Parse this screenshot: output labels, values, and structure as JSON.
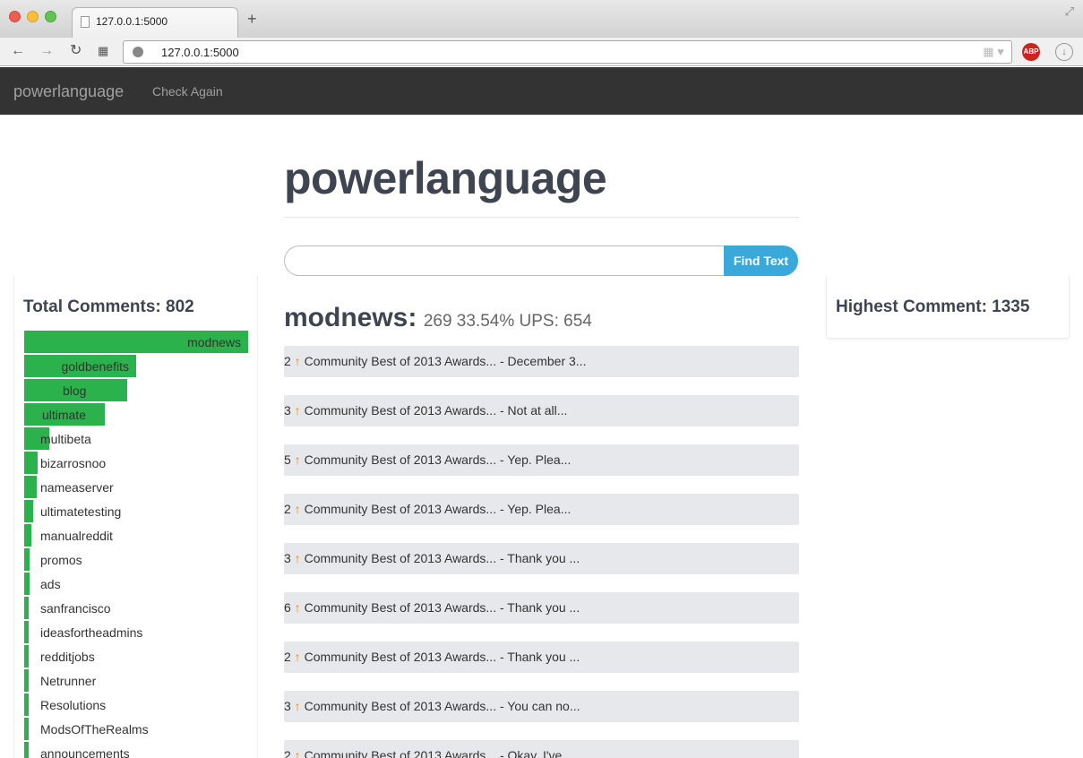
{
  "browser": {
    "tab_title": "127.0.0.1:5000",
    "url": "127.0.0.1:5000",
    "abp_label": "ABP"
  },
  "navbar": {
    "brand": "powerlanguage",
    "link": "Check Again"
  },
  "page": {
    "title": "powerlanguage",
    "search_placeholder": "",
    "find_button": "Find Text"
  },
  "left_panel": {
    "title": "Total Comments: 802",
    "subreddits": [
      {
        "name": "modnews",
        "fraction": 1.0
      },
      {
        "name": "goldbenefits",
        "fraction": 0.5
      },
      {
        "name": "blog",
        "fraction": 0.46
      },
      {
        "name": "ultimate",
        "fraction": 0.36
      },
      {
        "name": "multibeta",
        "fraction": 0.11
      },
      {
        "name": "bizarrosnoo",
        "fraction": 0.06
      },
      {
        "name": "nameaserver",
        "fraction": 0.055
      },
      {
        "name": "ultimatetesting",
        "fraction": 0.04
      },
      {
        "name": "manualreddit",
        "fraction": 0.03
      },
      {
        "name": "promos",
        "fraction": 0.025
      },
      {
        "name": "ads",
        "fraction": 0.025
      },
      {
        "name": "sanfrancisco",
        "fraction": 0.02
      },
      {
        "name": "ideasfortheadmins",
        "fraction": 0.02
      },
      {
        "name": "redditjobs",
        "fraction": 0.02
      },
      {
        "name": "Netrunner",
        "fraction": 0.02
      },
      {
        "name": "Resolutions",
        "fraction": 0.02
      },
      {
        "name": "ModsOfTheRealms",
        "fraction": 0.02
      },
      {
        "name": "announcements",
        "fraction": 0.02
      }
    ]
  },
  "main": {
    "subreddit": "modnews:",
    "stats": "269 33.54% UPS: 654",
    "comments": [
      {
        "score": "2",
        "text": "Community Best of 2013 Awards... - December 3..."
      },
      {
        "score": "3",
        "text": "Community Best of 2013 Awards... - Not at all..."
      },
      {
        "score": "5",
        "text": "Community Best of 2013 Awards... - Yep. Plea..."
      },
      {
        "score": "2",
        "text": "Community Best of 2013 Awards... - Yep. Plea..."
      },
      {
        "score": "3",
        "text": "Community Best of 2013 Awards... - Thank you ..."
      },
      {
        "score": "6",
        "text": "Community Best of 2013 Awards... - Thank you ..."
      },
      {
        "score": "2",
        "text": "Community Best of 2013 Awards... - Thank you ..."
      },
      {
        "score": "3",
        "text": "Community Best of 2013 Awards... - You can no..."
      },
      {
        "score": "2",
        "text": "Community Best of 2013 Awards... - Okay, I've"
      }
    ]
  },
  "right_panel": {
    "title": "Highest Comment: 1335"
  },
  "colors": {
    "navbar": "#333333",
    "bar": "#2bb24c",
    "button": "#3aa9d9",
    "comment_bg": "#e6e8ec",
    "arrow": "#f08a00"
  }
}
